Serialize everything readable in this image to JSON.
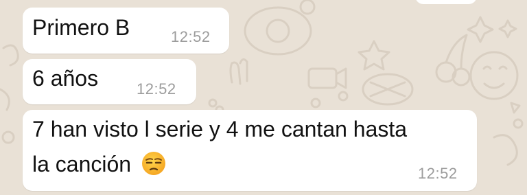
{
  "messages": [
    {
      "text": "Primero B",
      "time": "12:52"
    },
    {
      "text": "6 años",
      "time": "12:52"
    },
    {
      "line1": "7 han visto l serie y 4 me cantan hasta",
      "line2": "la canción",
      "emoji": "unamused-face-emoji",
      "time": "12:52"
    }
  ],
  "colors": {
    "wallpaper": "#e9e1d6",
    "bubble": "#ffffff",
    "timestamp": "#9c9c9c",
    "text": "#111111"
  }
}
